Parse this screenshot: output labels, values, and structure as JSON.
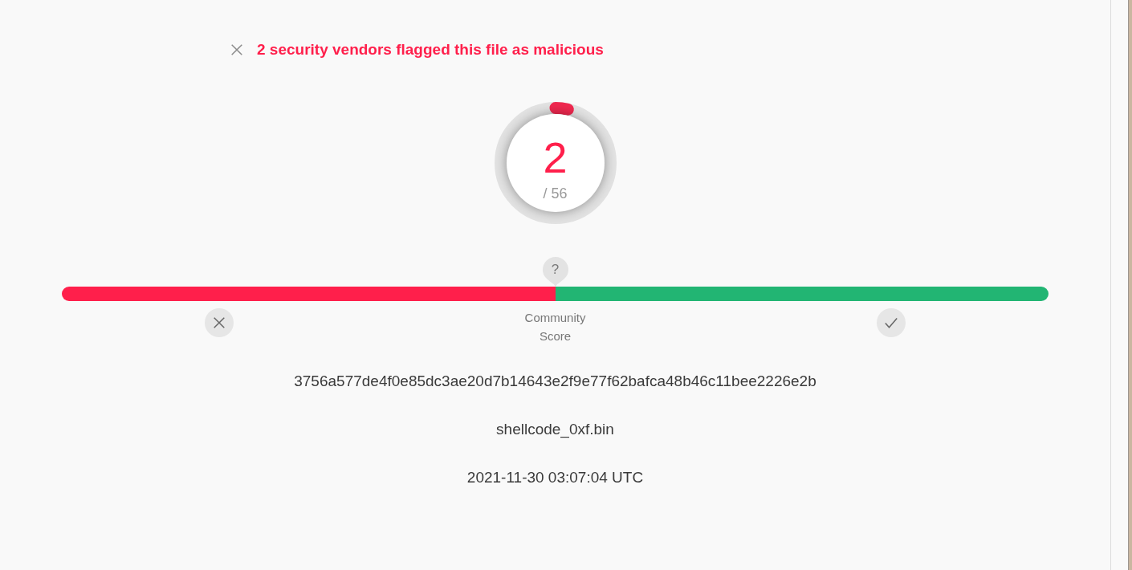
{
  "alert": {
    "text": "2 security vendors flagged this file as malicious"
  },
  "detections": {
    "count": "2",
    "total": "/ 56",
    "level": 0.036
  },
  "community_score": {
    "marker": "?",
    "level": 0.5,
    "label": "Community Score"
  },
  "file": {
    "hash": "3756a577de4f0e85dc3ae20d7b14643e2f9e77f62bafca48b46c11bee2226e2b",
    "name": "shellcode_0xf.bin",
    "date": "2021-11-30 03:07:04 UTC"
  }
}
